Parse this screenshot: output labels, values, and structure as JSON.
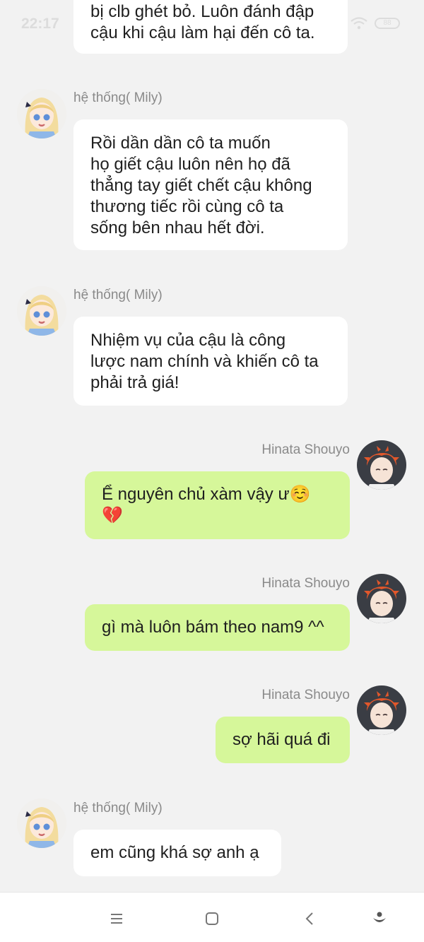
{
  "status_bar": {
    "time": "22:17",
    "battery": "88"
  },
  "messages": [
    {
      "side": "left",
      "sender": "",
      "text": "bị clb ghét bỏ. Luôn đánh đập\ncậu khi cậu làm hại đến cô ta."
    },
    {
      "side": "left",
      "sender": "hệ thống( Mily)",
      "text": "Rồi dần dần cô ta muốn\nhọ giết cậu luôn nên họ đã\nthẳng tay giết chết cậu không\nthương tiếc rồi cùng cô ta\nsống bên nhau hết đời."
    },
    {
      "side": "left",
      "sender": "hệ thống( Mily)",
      "text": "Nhiệm vụ của cậu là công\nlược nam chính và khiến cô ta\nphải trả giá!"
    },
    {
      "side": "right",
      "sender": "Hinata Shouyo",
      "text": "Ể nguyên chủ xàm vậy ư☺️\n💔"
    },
    {
      "side": "right",
      "sender": "Hinata Shouyo",
      "text": "gì mà luôn bám theo nam9 ^^"
    },
    {
      "side": "right",
      "sender": "Hinata Shouyo",
      "text": "sợ hãi quá đi"
    },
    {
      "side": "left",
      "sender": "hệ thống( Mily)",
      "text": "em cũng khá sợ anh ạ"
    }
  ],
  "nav_bar": {
    "icons": [
      "menu-icon",
      "home-square-icon",
      "back-chevron-icon",
      "assistant-icon"
    ]
  },
  "colors": {
    "background": "#f2f2f2",
    "left_bubble": "#ffffff",
    "right_bubble": "#d6f79a",
    "name_text": "#8a8a8a"
  }
}
